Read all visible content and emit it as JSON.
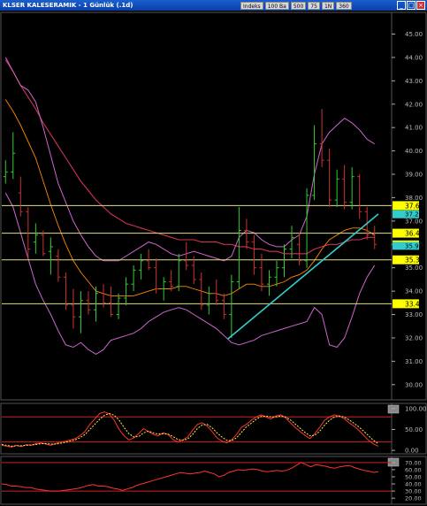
{
  "window": {
    "title": "KLSER KALESERAMIK - 1 Günlük (.1d)",
    "toolbar": [
      "Indeks",
      "100 Ba",
      "500",
      "75",
      "1N",
      "360"
    ],
    "buttons": [
      "minimize-button",
      "restore-button",
      "close-button"
    ]
  },
  "colors": {
    "background": "#000000",
    "up_candle": "#33cc33",
    "down_candle": "#cc3333",
    "bollinger": "#cc66cc",
    "ma_long": "#cc3355",
    "ma_short": "#ff8800",
    "trendline": "#33cccc",
    "hline": "#e0e080",
    "label_bg": "#ffff00"
  },
  "chart_data": [
    {
      "type": "candlestick",
      "ylim": [
        29.5,
        45.7
      ],
      "ticks": [
        "45.00",
        "44.00",
        "43.00",
        "42.00",
        "41.00",
        "40.00",
        "39.00",
        "38.00",
        "37.00",
        "36.00",
        "35.00",
        "34.00",
        "33.00",
        "32.00",
        "31.00",
        "30.00"
      ],
      "tick_values": [
        45,
        44,
        43,
        42,
        41,
        40,
        39,
        38,
        37,
        36,
        35,
        34,
        33,
        32,
        31,
        30
      ],
      "horizontal_levels": [
        {
          "value": 37.66,
          "label": "37.66"
        },
        {
          "value": 36.48,
          "label": "36.48"
        },
        {
          "value": 35.34,
          "label": "35.34"
        },
        {
          "value": 33.46,
          "label": "33.46"
        }
      ],
      "price_labels": [
        {
          "value": 37.29,
          "label": "37.29",
          "color": "#33cccc"
        },
        {
          "value": 36.0,
          "label": "36.00",
          "color": "#ffff00"
        },
        {
          "value": 35.94,
          "label": "35.94",
          "color": "#33cccc"
        }
      ],
      "candles": [
        {
          "o": 38.9,
          "h": 39.6,
          "l": 38.6,
          "c": 39.1
        },
        {
          "o": 39.1,
          "h": 40.8,
          "l": 38.8,
          "c": 39.9
        },
        {
          "o": 38.2,
          "h": 38.9,
          "l": 37.2,
          "c": 37.4
        },
        {
          "o": 37.4,
          "h": 37.6,
          "l": 35.4,
          "c": 35.8
        },
        {
          "o": 36.1,
          "h": 36.9,
          "l": 35.6,
          "c": 36.4
        },
        {
          "o": 36.4,
          "h": 36.6,
          "l": 35.5,
          "c": 35.6
        },
        {
          "o": 35.7,
          "h": 36.3,
          "l": 34.7,
          "c": 35.9
        },
        {
          "o": 35.5,
          "h": 35.8,
          "l": 34.4,
          "c": 34.6
        },
        {
          "o": 34.6,
          "h": 34.8,
          "l": 33.2,
          "c": 33.4
        },
        {
          "o": 33.4,
          "h": 34.1,
          "l": 32.4,
          "c": 32.9
        },
        {
          "o": 32.9,
          "h": 34.0,
          "l": 32.2,
          "c": 33.6
        },
        {
          "o": 33.6,
          "h": 34.0,
          "l": 33.0,
          "c": 33.2
        },
        {
          "o": 33.2,
          "h": 34.2,
          "l": 32.7,
          "c": 33.9
        },
        {
          "o": 33.9,
          "h": 34.3,
          "l": 33.3,
          "c": 33.5
        },
        {
          "o": 33.5,
          "h": 34.2,
          "l": 32.9,
          "c": 33.0
        },
        {
          "o": 33.0,
          "h": 33.9,
          "l": 32.8,
          "c": 33.7
        },
        {
          "o": 33.7,
          "h": 34.6,
          "l": 33.4,
          "c": 34.3
        },
        {
          "o": 34.3,
          "h": 35.1,
          "l": 34.0,
          "c": 34.9
        },
        {
          "o": 34.9,
          "h": 35.6,
          "l": 34.5,
          "c": 35.3
        },
        {
          "o": 35.3,
          "h": 35.8,
          "l": 34.9,
          "c": 35.0
        },
        {
          "o": 35.0,
          "h": 35.4,
          "l": 33.9,
          "c": 34.1
        },
        {
          "o": 34.1,
          "h": 34.6,
          "l": 33.6,
          "c": 34.4
        },
        {
          "o": 34.4,
          "h": 34.9,
          "l": 34.0,
          "c": 34.2
        },
        {
          "o": 34.2,
          "h": 35.6,
          "l": 34.0,
          "c": 35.3
        },
        {
          "o": 35.3,
          "h": 36.1,
          "l": 34.9,
          "c": 35.1
        },
        {
          "o": 35.1,
          "h": 35.5,
          "l": 34.3,
          "c": 34.5
        },
        {
          "o": 34.5,
          "h": 34.8,
          "l": 33.2,
          "c": 33.4
        },
        {
          "o": 33.4,
          "h": 34.2,
          "l": 33.0,
          "c": 33.9
        },
        {
          "o": 33.9,
          "h": 34.5,
          "l": 33.4,
          "c": 33.6
        },
        {
          "o": 33.6,
          "h": 33.9,
          "l": 32.8,
          "c": 33.0
        },
        {
          "o": 33.0,
          "h": 34.7,
          "l": 32.0,
          "c": 34.4
        },
        {
          "o": 34.4,
          "h": 37.6,
          "l": 34.1,
          "c": 36.6
        },
        {
          "o": 36.6,
          "h": 37.1,
          "l": 35.8,
          "c": 36.1
        },
        {
          "o": 36.1,
          "h": 36.4,
          "l": 34.7,
          "c": 35.0
        },
        {
          "o": 35.0,
          "h": 35.6,
          "l": 34.0,
          "c": 34.3
        },
        {
          "o": 34.3,
          "h": 34.9,
          "l": 33.8,
          "c": 34.6
        },
        {
          "o": 34.6,
          "h": 35.3,
          "l": 34.2,
          "c": 35.0
        },
        {
          "o": 35.0,
          "h": 36.0,
          "l": 34.6,
          "c": 35.8
        },
        {
          "o": 35.8,
          "h": 36.8,
          "l": 35.4,
          "c": 36.3
        },
        {
          "o": 36.0,
          "h": 36.5,
          "l": 35.1,
          "c": 35.3
        },
        {
          "o": 35.3,
          "h": 38.4,
          "l": 35.0,
          "c": 38.1
        },
        {
          "o": 38.1,
          "h": 41.1,
          "l": 37.9,
          "c": 40.3
        },
        {
          "o": 40.3,
          "h": 41.8,
          "l": 39.3,
          "c": 39.6
        },
        {
          "o": 39.6,
          "h": 40.1,
          "l": 37.6,
          "c": 37.9
        },
        {
          "o": 37.9,
          "h": 39.2,
          "l": 37.6,
          "c": 38.8
        },
        {
          "o": 38.8,
          "h": 39.4,
          "l": 37.5,
          "c": 37.8
        },
        {
          "o": 37.8,
          "h": 39.3,
          "l": 37.5,
          "c": 38.9
        },
        {
          "o": 38.9,
          "h": 39.0,
          "l": 37.1,
          "c": 37.4
        },
        {
          "o": 37.4,
          "h": 37.6,
          "l": 36.2,
          "c": 36.4
        },
        {
          "o": 36.4,
          "h": 36.8,
          "l": 35.8,
          "c": 36.0
        }
      ],
      "bollinger_upper": [
        44.0,
        43.4,
        42.8,
        42.6,
        42.1,
        41.0,
        39.8,
        38.6,
        37.8,
        37.0,
        36.4,
        35.9,
        35.5,
        35.3,
        35.3,
        35.3,
        35.5,
        35.7,
        35.9,
        36.1,
        36.0,
        35.8,
        35.6,
        35.5,
        35.6,
        35.7,
        35.6,
        35.5,
        35.4,
        35.3,
        35.5,
        36.3,
        36.6,
        36.5,
        36.2,
        36.0,
        35.9,
        35.9,
        36.2,
        36.4,
        37.2,
        39.0,
        40.3,
        40.8,
        41.1,
        41.4,
        41.2,
        40.9,
        40.5,
        40.3
      ],
      "bollinger_lower": [
        38.2,
        37.6,
        36.5,
        35.4,
        34.3,
        33.6,
        33.0,
        32.3,
        31.7,
        31.6,
        31.8,
        31.5,
        31.3,
        31.5,
        31.9,
        32.0,
        32.1,
        32.2,
        32.4,
        32.7,
        32.9,
        33.1,
        33.2,
        33.3,
        33.2,
        33.0,
        32.8,
        32.6,
        32.4,
        32.1,
        31.8,
        31.7,
        31.8,
        31.9,
        32.1,
        32.2,
        32.3,
        32.4,
        32.5,
        32.6,
        32.7,
        33.3,
        33.0,
        31.7,
        31.6,
        32.0,
        32.9,
        33.9,
        34.6,
        35.1
      ],
      "ma_long": [
        43.9,
        43.4,
        42.8,
        42.3,
        41.8,
        41.2,
        40.7,
        40.2,
        39.7,
        39.2,
        38.7,
        38.3,
        37.9,
        37.6,
        37.3,
        37.1,
        36.9,
        36.8,
        36.7,
        36.6,
        36.5,
        36.4,
        36.3,
        36.2,
        36.2,
        36.2,
        36.1,
        36.1,
        36.1,
        36.0,
        36.0,
        35.9,
        35.9,
        35.8,
        35.8,
        35.7,
        35.7,
        35.6,
        35.6,
        35.6,
        35.6,
        35.8,
        35.9,
        36.0,
        36.0,
        36.1,
        36.2,
        36.2,
        36.3,
        36.3
      ],
      "ma_short": [
        42.2,
        41.7,
        41.1,
        40.4,
        39.7,
        38.7,
        37.7,
        36.8,
        36.0,
        35.3,
        34.8,
        34.4,
        34.0,
        33.9,
        33.8,
        33.8,
        33.8,
        33.8,
        33.9,
        34.0,
        34.1,
        34.1,
        34.1,
        34.2,
        34.2,
        34.1,
        34.0,
        33.9,
        33.9,
        33.8,
        33.9,
        34.1,
        34.3,
        34.3,
        34.2,
        34.2,
        34.3,
        34.4,
        34.6,
        34.7,
        34.9,
        35.3,
        35.8,
        36.2,
        36.4,
        36.6,
        36.7,
        36.7,
        36.6,
        36.4
      ],
      "trendline": {
        "from_index": 29.5,
        "from_value": 31.95,
        "to_index": 49.5,
        "to_value": 37.3
      }
    },
    {
      "type": "line",
      "ylim": [
        -4,
        106
      ],
      "ticks": [
        "100.00",
        "50.00",
        "0.00"
      ],
      "tick_values": [
        100,
        50,
        0
      ],
      "levels": [
        80,
        20
      ],
      "series_k": [
        12,
        10,
        8,
        12,
        9,
        14,
        12,
        16,
        18,
        15,
        12,
        16,
        20,
        22,
        25,
        28,
        35,
        45,
        62,
        75,
        88,
        92,
        87,
        72,
        50,
        35,
        25,
        30,
        40,
        52,
        45,
        38,
        35,
        42,
        38,
        26,
        20,
        25,
        32,
        48,
        62,
        66,
        58,
        45,
        30,
        22,
        18,
        25,
        38,
        55,
        62,
        72,
        80,
        85,
        80,
        75,
        82,
        85,
        78,
        66,
        55,
        45,
        36,
        28,
        40,
        55,
        72,
        80,
        85,
        82,
        76,
        66,
        58,
        48,
        36,
        24,
        15,
        10
      ],
      "series_d": [
        14,
        12,
        10,
        11,
        11,
        12,
        13,
        14,
        16,
        16,
        15,
        15,
        17,
        19,
        22,
        25,
        30,
        38,
        50,
        62,
        74,
        84,
        88,
        84,
        72,
        55,
        40,
        32,
        33,
        42,
        46,
        42,
        39,
        40,
        39,
        33,
        26,
        24,
        27,
        38,
        52,
        61,
        62,
        54,
        42,
        32,
        24,
        23,
        30,
        43,
        56,
        65,
        74,
        81,
        82,
        80,
        80,
        82,
        80,
        73,
        63,
        53,
        43,
        35,
        36,
        46,
        60,
        72,
        80,
        82,
        80,
        73,
        65,
        56,
        46,
        35,
        24,
        16
      ]
    },
    {
      "type": "line",
      "ylim": [
        14,
        76
      ],
      "ticks": [
        "70.00",
        "60.00",
        "50.00",
        "40.00",
        "30.00",
        "20.00"
      ],
      "tick_values": [
        70,
        60,
        50,
        40,
        30,
        20
      ],
      "levels": [
        70,
        30
      ],
      "series": [
        40,
        39,
        37,
        37,
        36,
        35,
        35,
        33,
        32,
        31,
        30,
        30,
        30,
        31,
        32,
        33,
        34,
        36,
        38,
        39,
        37,
        37,
        36,
        34,
        33,
        31,
        33,
        35,
        38,
        40,
        42,
        44,
        46,
        48,
        50,
        52,
        54,
        56,
        55,
        54,
        55,
        56,
        58,
        56,
        54,
        50,
        52,
        56,
        58,
        60,
        59,
        60,
        61,
        60,
        58,
        57,
        58,
        59,
        58,
        59,
        62,
        66,
        70,
        67,
        64,
        67,
        66,
        65,
        63,
        62,
        64,
        65,
        66,
        63,
        61,
        59,
        58,
        56,
        57
      ]
    }
  ]
}
